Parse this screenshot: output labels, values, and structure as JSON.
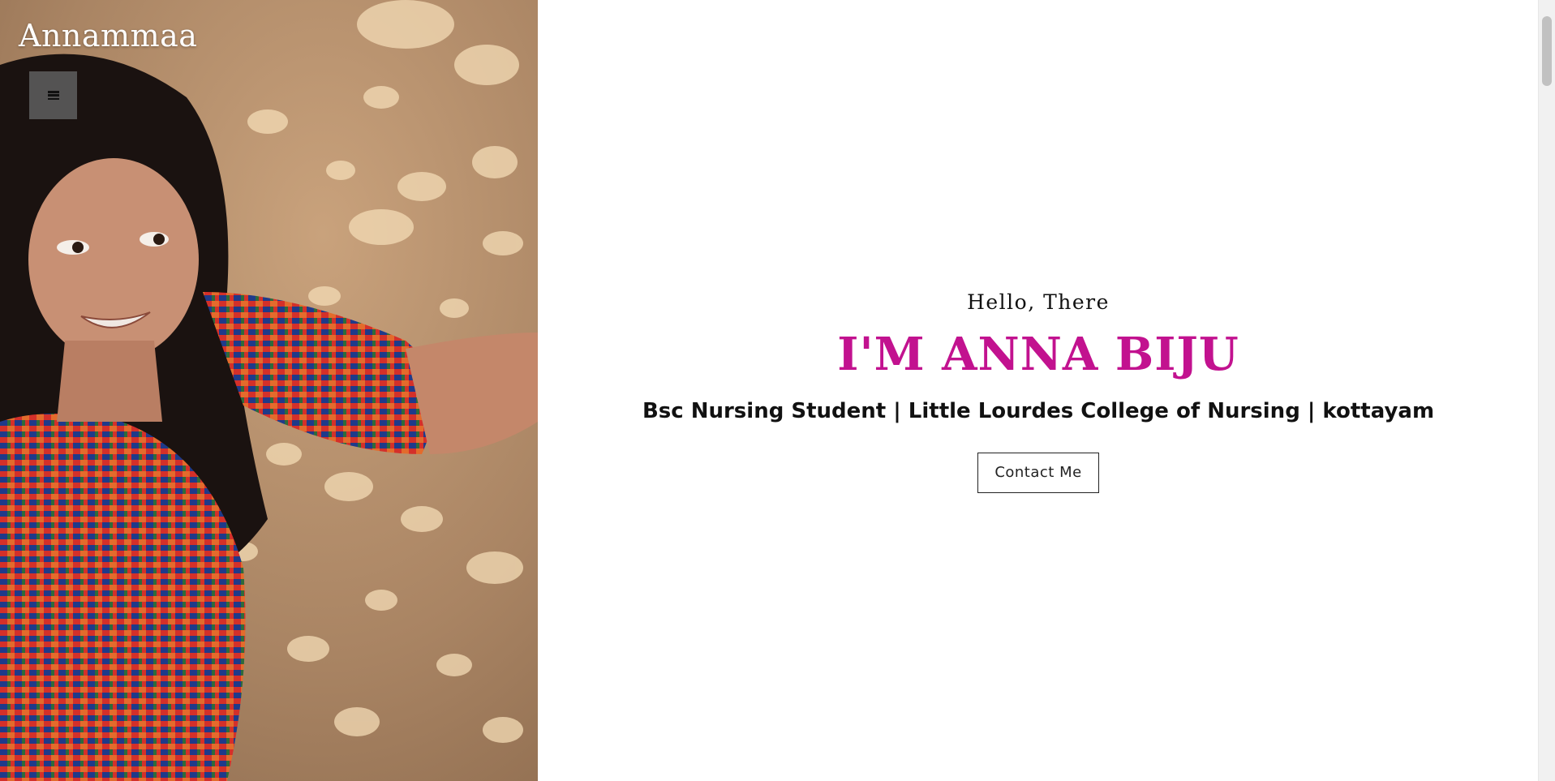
{
  "site": {
    "brand": "Annammaa"
  },
  "nav": {
    "menu_icon": "hamburger-icon"
  },
  "hero": {
    "greeting": "Hello, There",
    "name": "I'M ANNA BIJU",
    "tagline": "Bsc Nursing Student | Little Lourdes College of Nursing | kottayam",
    "cta_label": "Contact Me"
  },
  "colors": {
    "accent": "#c2128f",
    "text": "#111111",
    "menu_bg": "#5f5f5f"
  }
}
